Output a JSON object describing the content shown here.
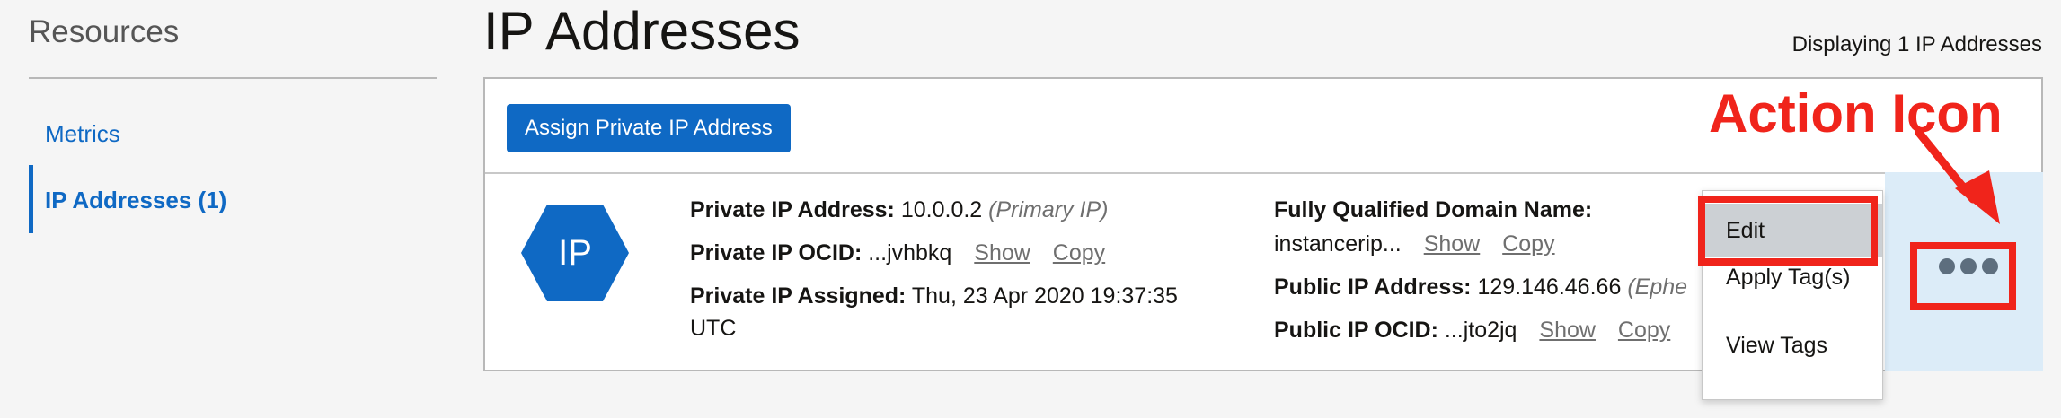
{
  "sidebar": {
    "title": "Resources",
    "items": [
      {
        "label": "Metrics"
      },
      {
        "label": "IP Addresses (1)"
      }
    ]
  },
  "header": {
    "title": "IP Addresses",
    "displaying": "Displaying 1 IP Addresses"
  },
  "toolbar": {
    "assign_label": "Assign Private IP Address"
  },
  "row": {
    "icon_text": "IP",
    "private_ip_label": "Private IP Address:",
    "private_ip_value": "10.0.0.2",
    "private_ip_note": "(Primary IP)",
    "private_ocid_label": "Private IP OCID:",
    "private_ocid_value": "...jvhbkq",
    "assigned_label": "Private IP Assigned:",
    "assigned_value_line1": "Thu, 23 Apr 2020 19:37:35",
    "assigned_value_line2": "UTC",
    "fqdn_label": "Fully Qualified Domain Name:",
    "fqdn_value": "instancerip...",
    "public_ip_label": "Public IP Address:",
    "public_ip_value": "129.146.46.66",
    "public_ip_note": "(Ephe",
    "public_ocid_label": "Public IP OCID:",
    "public_ocid_value": "...jto2jq",
    "show_label": "Show",
    "copy_label": "Copy"
  },
  "action_menu": {
    "items": [
      {
        "label": "Edit"
      },
      {
        "label": "Apply Tag(s)"
      },
      {
        "label": "View Tags"
      }
    ]
  },
  "annotation": {
    "label": "Action Icon",
    "color": "#f0241b"
  },
  "colors": {
    "accent": "#0f69c4",
    "action_cell_bg": "#dcecf8",
    "menu_highlight": "#ccd0d4"
  },
  "icons": [
    "ip-hexagon-icon",
    "more-actions-icon",
    "annotation-arrow-icon"
  ]
}
